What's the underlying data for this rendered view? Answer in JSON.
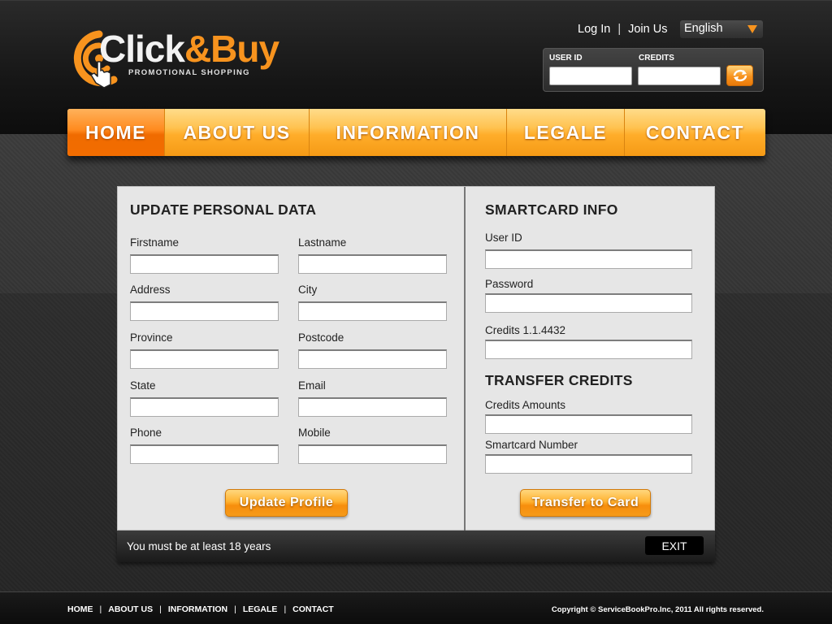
{
  "brand": {
    "logo_part1": "Click",
    "logo_part2": "&Buy",
    "tagline": "PROMOTIONAL SHOPPING",
    "accent_color": "#f7931e"
  },
  "header": {
    "login_label": "Log In",
    "separator": "|",
    "join_label": "Join Us",
    "language": "English",
    "user_id_label": "USER ID",
    "credits_label": "CREDITS",
    "user_id_value": "",
    "credits_value": "",
    "refresh_icon": "refresh-icon"
  },
  "nav": {
    "items": [
      {
        "label": "HOME",
        "active": true
      },
      {
        "label": "ABOUT US",
        "active": false
      },
      {
        "label": "INFORMATION",
        "active": false
      },
      {
        "label": "LEGALE",
        "active": false
      },
      {
        "label": "CONTACT",
        "active": false
      }
    ]
  },
  "personal": {
    "title": "UPDATE PERSONAL DATA",
    "fields": [
      {
        "label": "Firstname",
        "value": ""
      },
      {
        "label": "Lastname",
        "value": ""
      },
      {
        "label": "Address",
        "value": ""
      },
      {
        "label": "City",
        "value": ""
      },
      {
        "label": "Province",
        "value": ""
      },
      {
        "label": "Postcode",
        "value": ""
      },
      {
        "label": "State",
        "value": ""
      },
      {
        "label": "Email",
        "value": ""
      },
      {
        "label": "Phone",
        "value": ""
      },
      {
        "label": "Mobile",
        "value": ""
      }
    ],
    "button": "Update Profile"
  },
  "smartcard": {
    "title": "SMARTCARD INFO",
    "fields": [
      {
        "label": "User ID",
        "value": ""
      },
      {
        "label": "Password",
        "value": ""
      },
      {
        "label": "Credits 1.1.4432",
        "value": ""
      }
    ]
  },
  "transfer": {
    "title": "TRANSFER CREDITS",
    "fields": [
      {
        "label": "Credits Amounts",
        "value": ""
      },
      {
        "label": "Smartcard Number",
        "value": ""
      }
    ],
    "button": "Transfer to Card"
  },
  "panel_footer": {
    "note": "You must be at least 18 years",
    "exit": "EXIT"
  },
  "footer": {
    "links": [
      "HOME",
      "ABOUT US",
      "INFORMATION",
      "LEGALE",
      "CONTACT"
    ],
    "separator": "|",
    "copyright": "Copyright © ServiceBookPro.Inc, 2011 All rights reserved."
  }
}
